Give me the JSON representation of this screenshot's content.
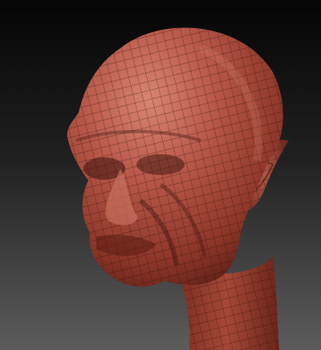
{
  "scene": {
    "subject": "sculpted-head-wireframe",
    "colors": {
      "bg_top": "#050505",
      "bg_bottom": "#5a5a5a",
      "skin_light": "#d27a66",
      "skin_mid": "#a94a3a",
      "skin_dark": "#5a1f16",
      "wire": "#2a0d08"
    }
  }
}
